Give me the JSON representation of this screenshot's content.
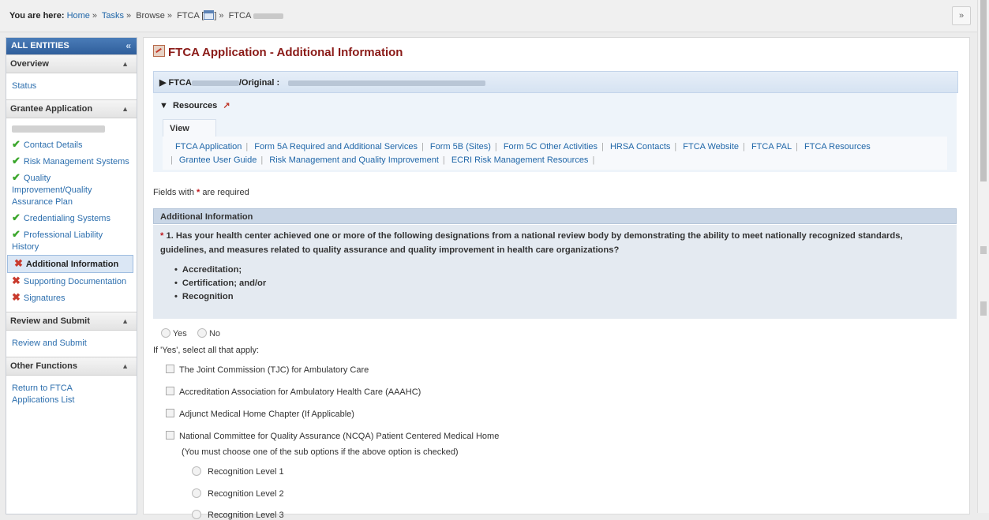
{
  "breadcrumb": {
    "prefix": "You are here:",
    "home": "Home",
    "tasks": "Tasks",
    "browse": "Browse",
    "ftca": "FTCA [",
    "ftca_close": "]",
    "last": "FTCA"
  },
  "sidebar": {
    "header": "ALL ENTITIES",
    "sections": {
      "overview": {
        "title": "Overview",
        "items": [
          "Status"
        ]
      },
      "grantee": {
        "title": "Grantee Application"
      },
      "review": {
        "title": "Review and Submit",
        "items": [
          "Review and Submit"
        ]
      },
      "other": {
        "title": "Other Functions",
        "items": [
          "Return to FTCA Applications List"
        ]
      }
    },
    "grantee_items": [
      {
        "label": "Contact Details",
        "status": "complete"
      },
      {
        "label": "Risk Management Systems",
        "status": "complete"
      },
      {
        "label": "Quality Improvement/Quality Assurance Plan",
        "status": "complete"
      },
      {
        "label": "Credentialing Systems",
        "status": "complete"
      },
      {
        "label": "Professional Liability History",
        "status": "complete"
      },
      {
        "label": "Additional Information",
        "status": "incomplete"
      },
      {
        "label": "Supporting Documentation",
        "status": "incomplete"
      },
      {
        "label": "Signatures",
        "status": "incomplete"
      }
    ]
  },
  "main": {
    "title": "FTCA Application - Additional Information",
    "ftca_bar_prefix": "FTCA",
    "ftca_bar_mid": "/Original :",
    "resources": {
      "title": "Resources",
      "tab": "View",
      "links_row1": [
        "FTCA Application",
        "Form 5A Required and Additional Services",
        "Form 5B (Sites)",
        "Form 5C Other Activities",
        "HRSA Contacts",
        "FTCA Website",
        "FTCA PAL",
        "FTCA Resources"
      ],
      "links_row2": [
        "Grantee User Guide",
        "Risk Management and Quality Improvement",
        "ECRI Risk Management Resources"
      ]
    },
    "required_note_pre": "Fields with",
    "required_note_post": "are required",
    "section_title": "Additional Information",
    "question": "1. Has your health center achieved one or more of the following designations from a national review body by demonstrating the ability to meet nationally recognized standards, guidelines, and measures related to quality assurance and quality improvement in health care organizations?",
    "designations": [
      "Accreditation;",
      "Certification; and/or",
      "Recognition"
    ],
    "yes_label": "Yes",
    "no_label": "No",
    "if_yes_label": "If 'Yes', select all that apply:",
    "options": [
      "The Joint Commission (TJC) for Ambulatory Care",
      "Accreditation Association for Ambulatory Health Care (AAAHC)",
      "Adjunct Medical Home Chapter (If Applicable)",
      "National Committee for Quality Assurance (NCQA) Patient Centered Medical Home"
    ],
    "ncqa_note": "(You must choose one of the sub options if the above option is checked)",
    "levels": [
      "Recognition Level 1",
      "Recognition Level 2",
      "Recognition Level 3"
    ]
  },
  "colors": {
    "title": "#8a1a17",
    "link": "#1f66a8",
    "ok": "#3aa62b",
    "error": "#c93b2e",
    "sidebar_header": "#2f5e9b"
  }
}
